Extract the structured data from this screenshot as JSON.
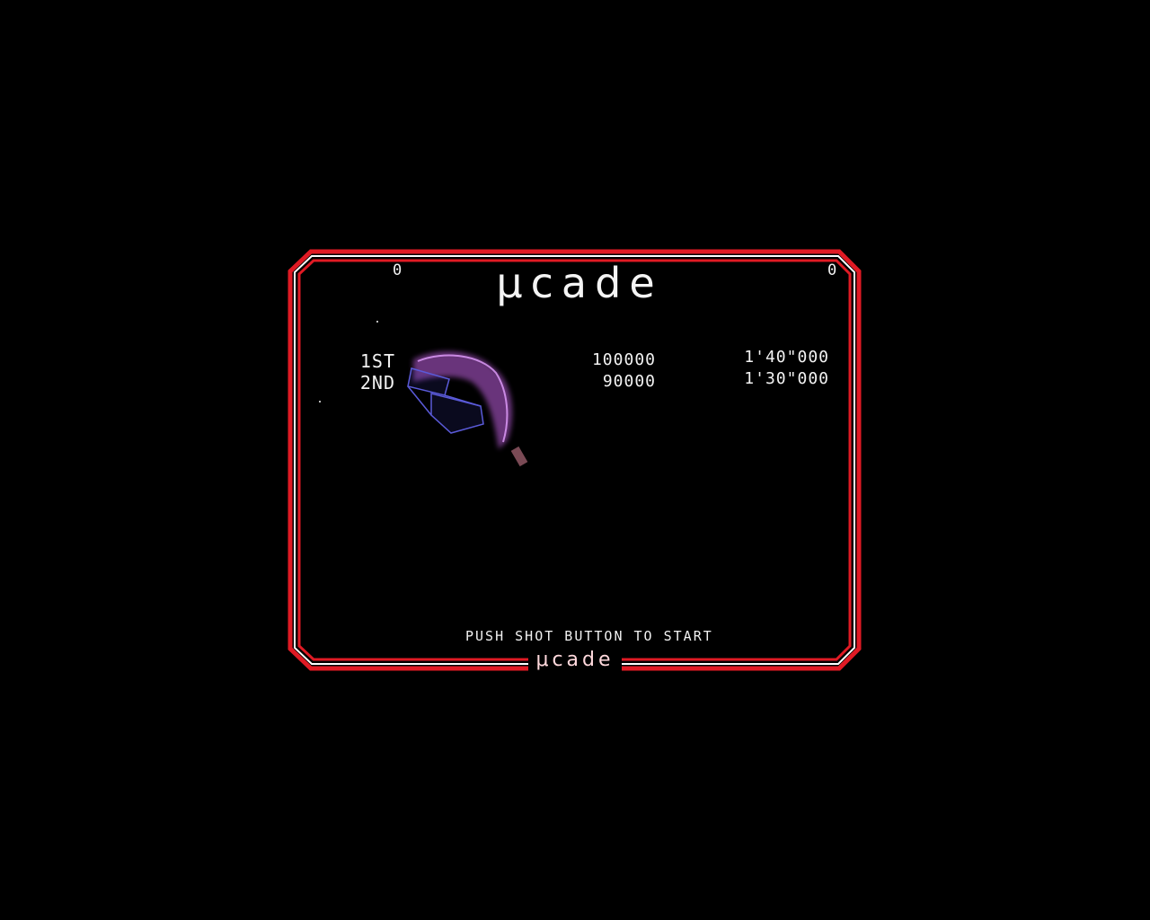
{
  "game": {
    "title_mu": "μ",
    "title_rest": "cade",
    "score_left": "0",
    "score_right": "0",
    "ranking": [
      {
        "rank": "1ST",
        "score": "100000",
        "time": "1'40\"000"
      },
      {
        "rank": "2ND",
        "score": "90000",
        "time": "1'30\"000"
      }
    ],
    "prompt": "PUSH SHOT BUTTON TO START",
    "footer_logo": "μcade"
  },
  "colors": {
    "background": "#000000",
    "frame": "#e01a24",
    "frame_inner": "#ffffff",
    "text": "#f2f2f2",
    "glow": "#c060e0",
    "wire": "#5a5ad8"
  }
}
